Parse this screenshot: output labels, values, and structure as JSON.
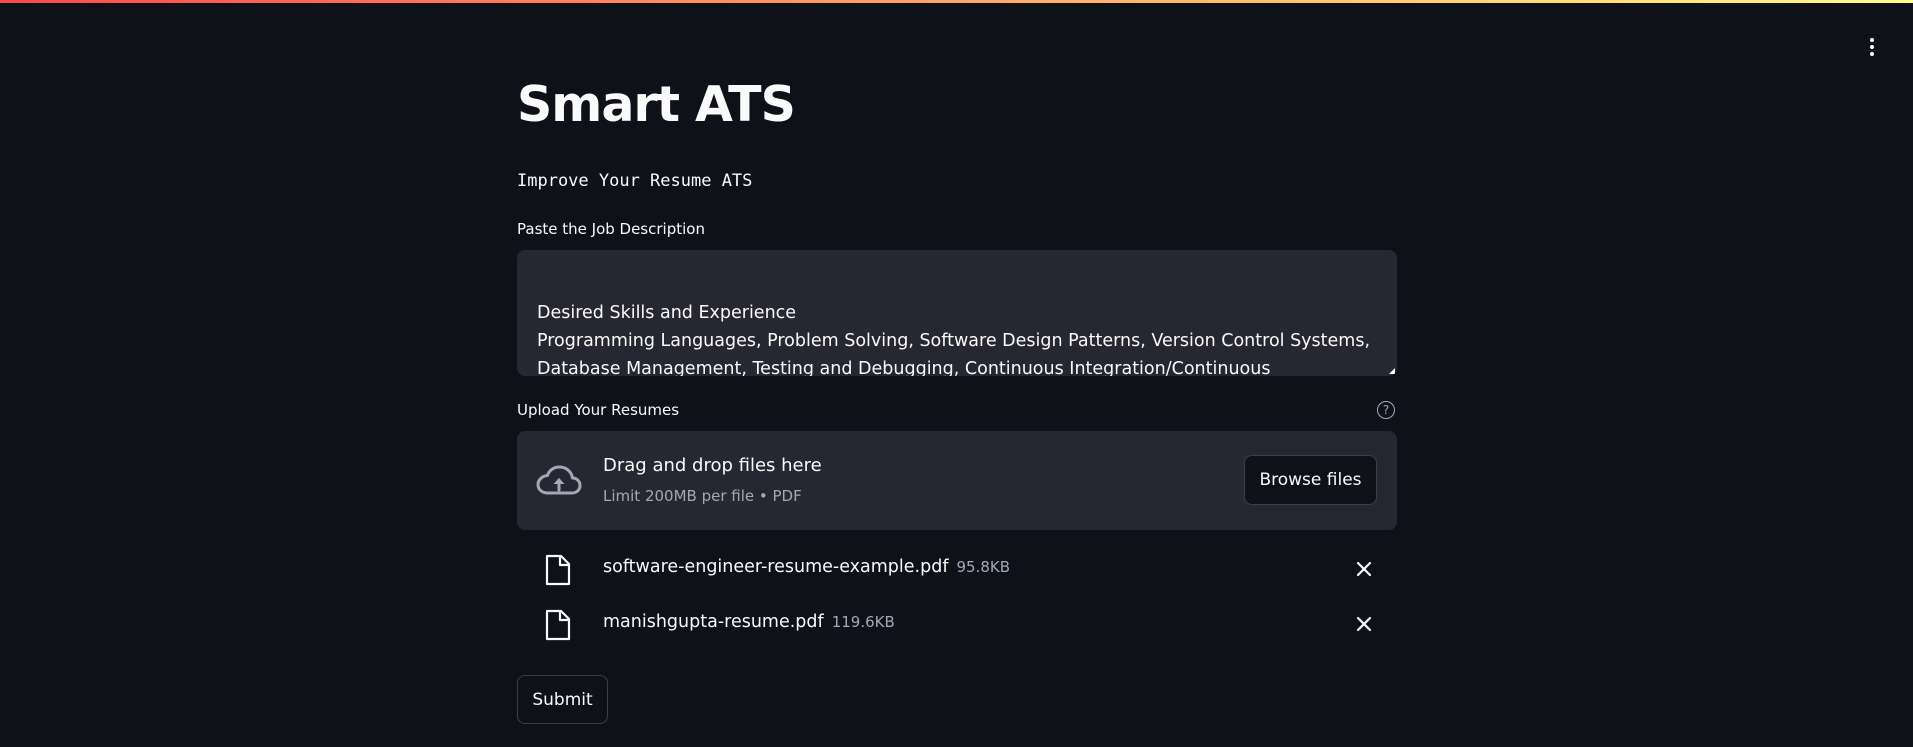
{
  "app": {
    "title": "Smart ATS",
    "subtitle": "Improve Your Resume ATS"
  },
  "job_description": {
    "label": "Paste the Job Description",
    "value": "Desired Skills and Experience\nProgramming Languages, Problem Solving, Software Design Patterns, Version Control Systems, Database Management, Testing and Debugging, Continuous Integration/Continuous Deployment"
  },
  "uploader": {
    "label": "Upload Your Resumes",
    "help_icon": "question-circle-icon",
    "drop_title": "Drag and drop files here",
    "drop_limit": "Limit 200MB per file • PDF",
    "browse_label": "Browse files",
    "files": [
      {
        "name": "software-engineer-resume-example.pdf",
        "size": "95.8KB"
      },
      {
        "name": "manishgupta-resume.pdf",
        "size": "119.6KB"
      }
    ]
  },
  "submit_label": "Submit",
  "colors": {
    "background": "#0e1117",
    "surface": "#262730",
    "text": "#fafafa",
    "muted": "#a3a8b8",
    "accent_start": "#ff4b4b",
    "accent_end": "#fffd80"
  }
}
